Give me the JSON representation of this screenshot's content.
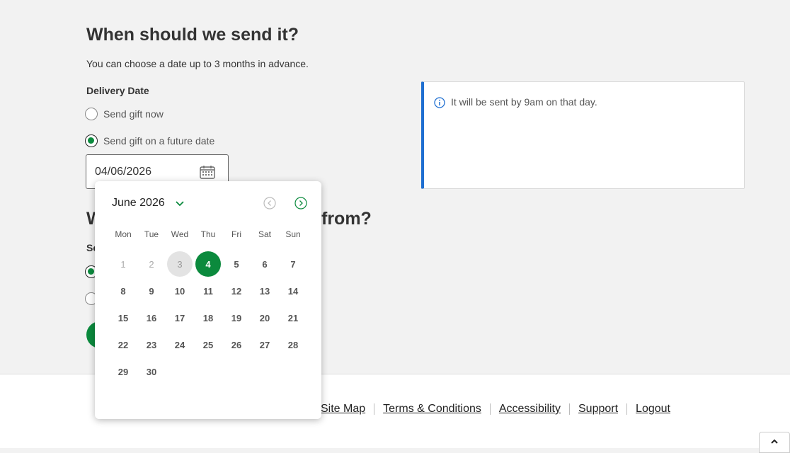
{
  "send": {
    "heading": "When should we send it?",
    "subtext": "You can choose a date up to 3 months in advance.",
    "delivery_label": "Delivery Date",
    "option_now": "Send gift now",
    "option_future": "Send gift on a future date",
    "date_value": "04/06/2026"
  },
  "info": {
    "text": "It will be sent by 9am on that day."
  },
  "from": {
    "heading_start": "W",
    "heading_end": "from?",
    "label_fragment": "Se"
  },
  "calendar": {
    "month_label": "June 2026",
    "weekdays": [
      "Mon",
      "Tue",
      "Wed",
      "Thu",
      "Fri",
      "Sat",
      "Sun"
    ],
    "disabled_days": [
      1,
      2,
      3
    ],
    "today": 3,
    "selected": 4,
    "days": [
      1,
      2,
      3,
      4,
      5,
      6,
      7,
      8,
      9,
      10,
      11,
      12,
      13,
      14,
      15,
      16,
      17,
      18,
      19,
      20,
      21,
      22,
      23,
      24,
      25,
      26,
      27,
      28,
      29,
      30
    ]
  },
  "footer": {
    "links": [
      "Site Map",
      "Terms & Conditions",
      "Accessibility",
      "Support",
      "Logout"
    ]
  },
  "colors": {
    "accent": "#0b8a3d",
    "info_border": "#1f6fd1"
  }
}
